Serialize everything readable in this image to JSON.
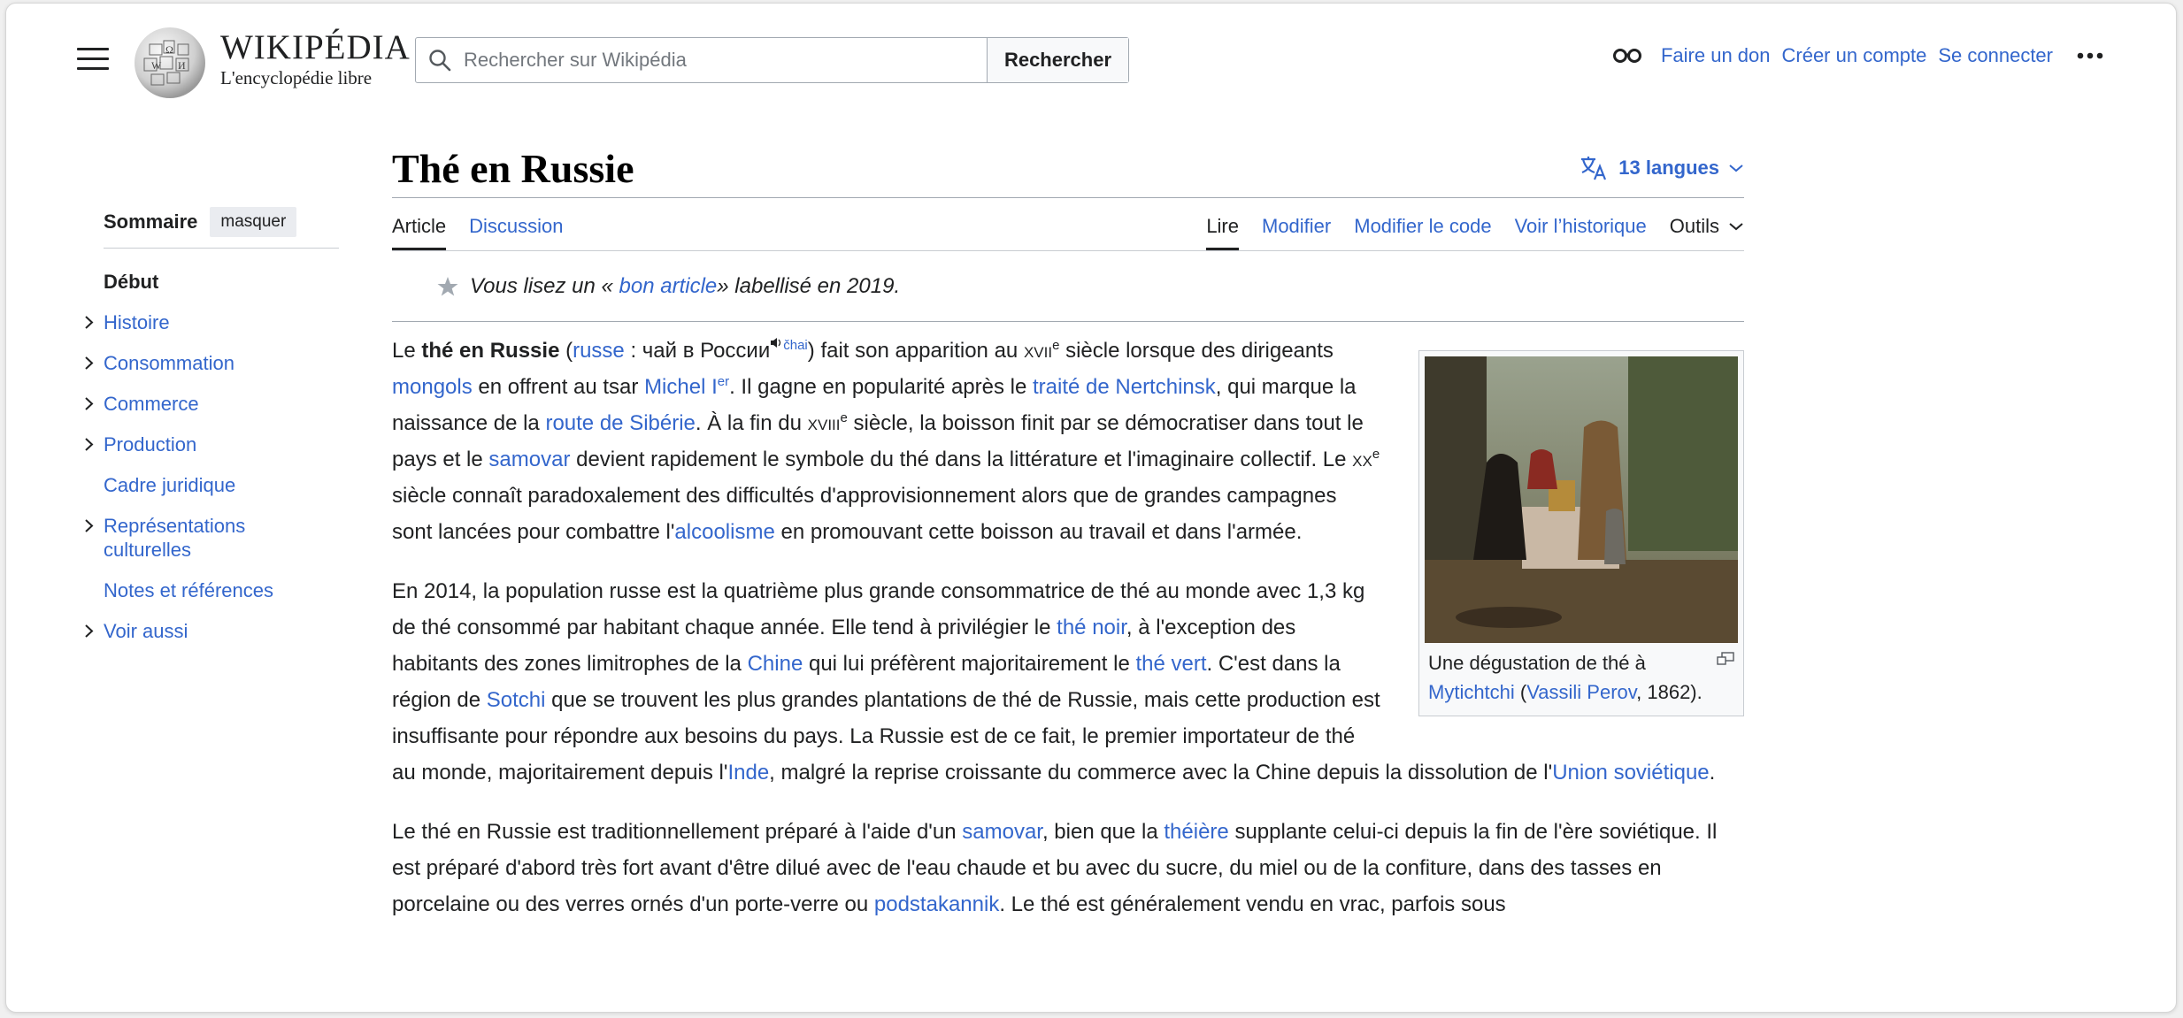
{
  "header": {
    "logo_title": "WIKIPÉDIA",
    "logo_subtitle": "L'encyclopédie libre",
    "search_placeholder": "Rechercher sur Wikipédia",
    "search_button": "Rechercher",
    "links": [
      "Faire un don",
      "Créer un compte",
      "Se connecter"
    ]
  },
  "toc": {
    "title": "Sommaire",
    "hide": "masquer",
    "items": [
      {
        "label": "Début",
        "expandable": false
      },
      {
        "label": "Histoire",
        "expandable": true
      },
      {
        "label": "Consommation",
        "expandable": true
      },
      {
        "label": "Commerce",
        "expandable": true
      },
      {
        "label": "Production",
        "expandable": true
      },
      {
        "label": "Cadre juridique",
        "expandable": false
      },
      {
        "label": "Représentations culturelles",
        "expandable": true
      },
      {
        "label": "Notes et références",
        "expandable": false
      },
      {
        "label": "Voir aussi",
        "expandable": true
      }
    ]
  },
  "article": {
    "title": "Thé en Russie",
    "languages": "13 langues",
    "tabs_left": [
      "Article",
      "Discussion"
    ],
    "tabs_right": [
      "Lire",
      "Modifier",
      "Modifier le code",
      "Voir l’historique",
      "Outils"
    ],
    "good_article": {
      "prefix": "Vous lisez un « ",
      "link": "bon article",
      "suffix": " » labellisé en 2019."
    },
    "figure_caption": {
      "pre": "Une dégustation de thé à ",
      "link1": "Mytichtchi",
      "mid": " (",
      "link2": "Vassili Perov",
      "post": ", 1862)."
    }
  },
  "p1": {
    "a": "Le ",
    "b": "thé en Russie",
    "c": " (",
    "russe": "russe",
    "d": " : чай в России",
    "chai": "čhai",
    "e": ") fait son apparition au ",
    "xvii": "xvii",
    "sup1": "e",
    "f": " siècle lorsque des dirigeants ",
    "mongols": "mongols",
    "g": " en offrent au tsar ",
    "michel": "Michel I",
    "er": "er",
    "h": ". Il gagne en popularité après le ",
    "traite": "traité de Nertchinsk",
    "i": ", qui marque la naissance de la ",
    "route": "route de Sibérie",
    "j": ". À la fin du ",
    "xviii": "xviii",
    "sup2": "e",
    "k": " siècle, la boisson finit par se démocratiser dans tout le pays et le ",
    "samovar": "samovar",
    "l": " devient rapidement le symbole du thé dans la littérature et l'imaginaire collectif. Le ",
    "xx": "xx",
    "sup3": "e",
    "m": " siècle connaît paradoxalement des difficultés d'approvisionnement alors que de grandes campagnes sont lancées pour combattre l'",
    "alcool": "alcoolisme",
    "n": " en promouvant cette boisson au travail et dans l'armée."
  },
  "p2": {
    "a": "En 2014, la population russe est la quatrième plus grande consommatrice de thé au monde avec 1,3 kg de thé consommé par habitant chaque année. Elle tend à privilégier le ",
    "noir": "thé noir",
    "b": ", à l'exception des habitants des zones limitrophes de la ",
    "chine": "Chine",
    "c": " qui lui préfèrent majoritairement le ",
    "vert": "thé vert",
    "d": ". C'est dans la région de ",
    "sotchi": "Sotchi",
    "e": " que se trouvent les plus grandes plantations de thé de Russie, mais cette production est insuffisante pour répondre aux besoins du pays. La Russie est de ce fait, le premier importateur de thé au monde, majoritairement depuis l'",
    "inde": "Inde",
    "f": ", malgré la reprise croissante du commerce avec la Chine depuis la dissolution de l'",
    "urss": "Union soviétique",
    "g": "."
  },
  "p3": {
    "a": "Le thé en Russie est traditionnellement préparé à l'aide d'un ",
    "samovar": "samovar",
    "b": ", bien que la ",
    "theiere": "théière",
    "c": " supplante celui-ci depuis la fin de l'ère soviétique. Il est préparé d'abord très fort avant d'être dilué avec de l'eau chaude et bu avec du sucre, du miel ou de la confiture, dans des tasses en porcelaine ou des verres ornés d'un porte-verre ou ",
    "podsta": "podstakannik",
    "d": ". Le thé est généralement vendu en vrac, parfois sous"
  },
  "icons": {
    "menu": "hamburger-icon",
    "search": "search-icon",
    "glasses": "glasses-icon",
    "more": "ellipsis-icon",
    "language": "language-icon",
    "star": "star-icon",
    "speaker": "speaker-icon",
    "enlarge": "enlarge-icon"
  },
  "colors": {
    "link": "#3366cc",
    "text": "#202122",
    "border": "#a2a9b1"
  }
}
